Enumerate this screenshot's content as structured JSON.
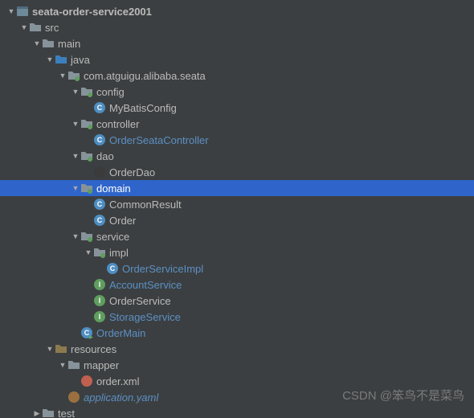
{
  "watermark": "CSDN @笨鸟不是菜鸟",
  "tree": {
    "root": {
      "label": "seata-order-service2001",
      "arrow": "open",
      "icon": "module",
      "indent": 0,
      "style": "bold",
      "children": [
        {
          "label": "src",
          "arrow": "open",
          "icon": "folder",
          "indent": 1,
          "children": [
            {
              "label": "main",
              "arrow": "open",
              "icon": "folder",
              "indent": 2,
              "children": [
                {
                  "label": "java",
                  "arrow": "open",
                  "icon": "src-folder",
                  "indent": 3,
                  "children": [
                    {
                      "label": "com.atguigu.alibaba.seata",
                      "arrow": "open",
                      "icon": "package",
                      "indent": 4,
                      "children": [
                        {
                          "label": "config",
                          "arrow": "open",
                          "icon": "package",
                          "indent": 5,
                          "children": [
                            {
                              "label": "MyBatisConfig",
                              "arrow": "empty",
                              "icon": "class",
                              "indent": 6
                            }
                          ]
                        },
                        {
                          "label": "controller",
                          "arrow": "open",
                          "icon": "package",
                          "indent": 5,
                          "children": [
                            {
                              "label": "OrderSeataController",
                              "arrow": "empty",
                              "icon": "class",
                              "indent": 6,
                              "style": "link"
                            }
                          ]
                        },
                        {
                          "label": "dao",
                          "arrow": "open",
                          "icon": "package",
                          "indent": 5,
                          "children": [
                            {
                              "label": "OrderDao",
                              "arrow": "empty",
                              "icon": "interface-dark",
                              "indent": 6
                            }
                          ]
                        },
                        {
                          "label": "domain",
                          "arrow": "open",
                          "icon": "package",
                          "indent": 5,
                          "selected": true,
                          "children": [
                            {
                              "label": "CommonResult",
                              "arrow": "empty",
                              "icon": "class",
                              "indent": 6
                            },
                            {
                              "label": "Order",
                              "arrow": "empty",
                              "icon": "class",
                              "indent": 6
                            }
                          ]
                        },
                        {
                          "label": "service",
                          "arrow": "open",
                          "icon": "package",
                          "indent": 5,
                          "children": [
                            {
                              "label": "impl",
                              "arrow": "open",
                              "icon": "package",
                              "indent": 6,
                              "children": [
                                {
                                  "label": "OrderServiceImpl",
                                  "arrow": "empty",
                                  "icon": "class",
                                  "indent": 7,
                                  "style": "link"
                                }
                              ]
                            },
                            {
                              "label": "AccountService",
                              "arrow": "empty",
                              "icon": "interface",
                              "indent": 6,
                              "style": "link"
                            },
                            {
                              "label": "OrderService",
                              "arrow": "empty",
                              "icon": "interface",
                              "indent": 6
                            },
                            {
                              "label": "StorageService",
                              "arrow": "empty",
                              "icon": "interface",
                              "indent": 6,
                              "style": "link"
                            }
                          ]
                        },
                        {
                          "label": "OrderMain",
                          "arrow": "empty",
                          "icon": "runnable",
                          "indent": 5,
                          "style": "link"
                        }
                      ]
                    }
                  ]
                },
                {
                  "label": "resources",
                  "arrow": "open",
                  "icon": "res-folder",
                  "indent": 3,
                  "children": [
                    {
                      "label": "mapper",
                      "arrow": "open",
                      "icon": "folder",
                      "indent": 4,
                      "children": [
                        {
                          "label": "order.xml",
                          "arrow": "empty",
                          "icon": "xml",
                          "indent": 5
                        }
                      ]
                    },
                    {
                      "label": "application.yaml",
                      "arrow": "empty",
                      "icon": "yaml",
                      "indent": 4,
                      "style": "ital"
                    }
                  ]
                }
              ]
            },
            {
              "label": "test",
              "arrow": "closed",
              "icon": "folder",
              "indent": 2
            }
          ]
        }
      ]
    }
  },
  "icons": {
    "module": {
      "type": "square",
      "fill": "#6e8999",
      "letter": ""
    },
    "folder": {
      "type": "folder",
      "fill": "#87939a"
    },
    "src-folder": {
      "type": "folder",
      "fill": "#3c7fbf"
    },
    "res-folder": {
      "type": "folder",
      "fill": "#8c7a4f"
    },
    "package": {
      "type": "folder-dot",
      "fill": "#87939a",
      "dot": "#5f9e5f"
    },
    "class": {
      "type": "circle",
      "fill": "#4e8ec2",
      "letter": "C"
    },
    "interface": {
      "type": "circle",
      "fill": "#5f9e5f",
      "letter": "I"
    },
    "interface-dark": {
      "type": "circle",
      "fill": "#3b3b3b",
      "letter": ""
    },
    "runnable": {
      "type": "circle-run",
      "fill": "#4e8ec2",
      "letter": "C"
    },
    "xml": {
      "type": "circle",
      "fill": "#c06050",
      "letter": ""
    },
    "yaml": {
      "type": "circle",
      "fill": "#9a7040",
      "letter": ""
    }
  }
}
